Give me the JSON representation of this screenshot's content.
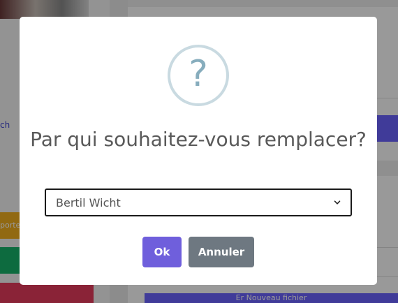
{
  "background": {
    "link_text": "ch",
    "orange_button_label": "porte",
    "purple_button_label": "Er Nouveau fichier"
  },
  "dialog": {
    "icon": "question-mark-icon",
    "icon_glyph": "?",
    "title": "Par qui souhaitez-vous remplacer?",
    "select": {
      "selected": "Bertil Wicht"
    },
    "ok_label": "Ok",
    "cancel_label": "Annuler"
  },
  "colors": {
    "ok_button": "#6f5fdc",
    "cancel_button": "#6e7881",
    "icon_ring": "#c9dae1",
    "icon_glyph": "#87adbd"
  }
}
